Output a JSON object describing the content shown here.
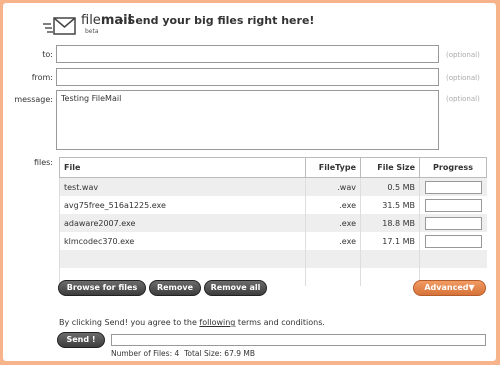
{
  "header": {
    "brand_part1": "file",
    "brand_part2": "mail",
    "beta": "beta",
    "tagline": "- Send your big files right here!"
  },
  "form": {
    "to": {
      "label": "to:",
      "value": "",
      "optional": "(optional)"
    },
    "from": {
      "label": "from:",
      "value": "",
      "optional": "(optional)"
    },
    "message": {
      "label": "message:",
      "value": "Testing FileMail",
      "optional": "(optional)"
    },
    "files_label": "files:"
  },
  "table": {
    "headers": {
      "file": "File",
      "type": "FileType",
      "size": "File Size",
      "progress": "Progress"
    },
    "rows": [
      {
        "file": "test.wav",
        "type": ".wav",
        "size": "0.5 MB",
        "progress": 0
      },
      {
        "file": "avg75free_516a1225.exe",
        "type": ".exe",
        "size": "31.5 MB",
        "progress": 0
      },
      {
        "file": "adaware2007.exe",
        "type": ".exe",
        "size": "18.8 MB",
        "progress": 0
      },
      {
        "file": "klmcodec370.exe",
        "type": ".exe",
        "size": "17.1 MB",
        "progress": 0
      }
    ]
  },
  "buttons": {
    "browse": "Browse for files",
    "remove": "Remove",
    "remove_all": "Remove all",
    "advanced": "Advanced▼",
    "send": "Send !"
  },
  "terms": {
    "prefix": "By clicking Send! you agree to the ",
    "link": "following",
    "suffix": " terms and conditions."
  },
  "summary": {
    "files_label": "Number of Files:",
    "files_count": "4",
    "size_label": "Total Size:",
    "size_value": "67.9 MB"
  },
  "colors": {
    "frame": "#f7b48a",
    "button": "#4a4a4a",
    "advanced": "#e88a50"
  }
}
